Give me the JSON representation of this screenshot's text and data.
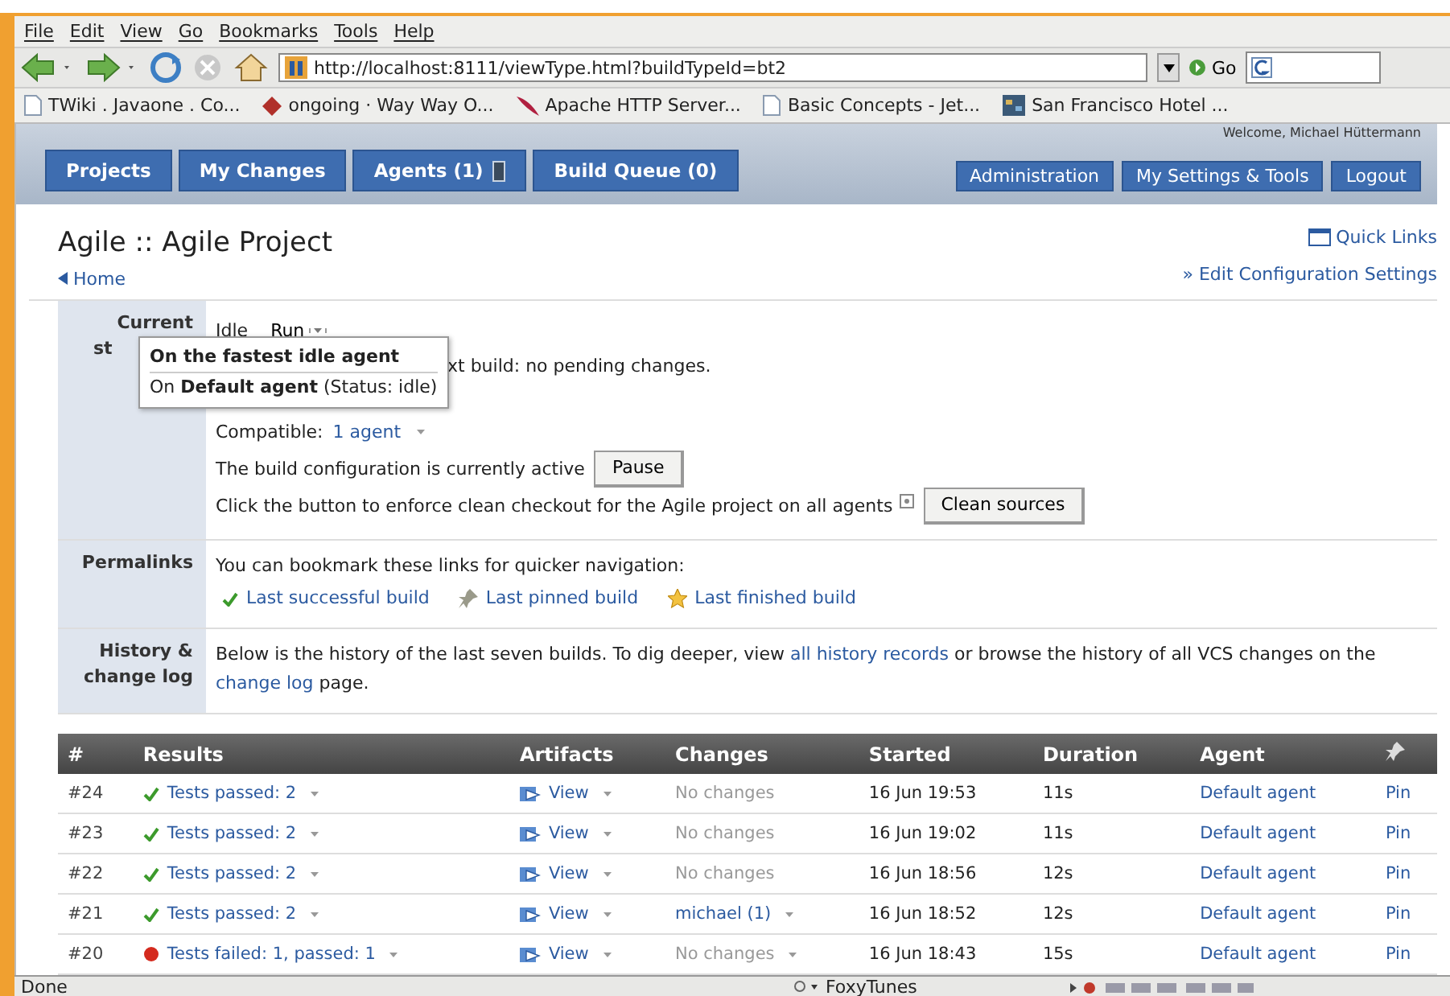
{
  "menu_bar": [
    "File",
    "Edit",
    "View",
    "Go",
    "Bookmarks",
    "Tools",
    "Help"
  ],
  "address_bar": {
    "url": "http://localhost:8111/viewType.html?buildTypeId=bt2",
    "go": "Go"
  },
  "bookmarks": [
    {
      "label": "TWiki . Javaone . Co...",
      "kind": "page"
    },
    {
      "label": "ongoing · Way Way O...",
      "kind": "diamond"
    },
    {
      "label": "Apache HTTP Server...",
      "kind": "feather"
    },
    {
      "label": "Basic Concepts - Jet...",
      "kind": "page"
    },
    {
      "label": "San Francisco Hotel ...",
      "kind": "hotel"
    }
  ],
  "welcome": "Welcome, Michael Hüttermann",
  "nav_tabs": [
    {
      "label": "Projects",
      "kind": "plain"
    },
    {
      "label": "My Changes",
      "kind": "plain"
    },
    {
      "label": "Agents (1)",
      "kind": "agents"
    },
    {
      "label": "Build Queue (0)",
      "kind": "plain"
    }
  ],
  "nav_links": [
    "Administration",
    "My Settings & Tools",
    "Logout"
  ],
  "page_title": "Agile :: Agile Project",
  "quick_links": "Quick Links",
  "home_link": "Home",
  "edit_settings": "» Edit Configuration Settings",
  "current_status": {
    "label_lines": [
      "Current",
      "st"
    ],
    "state": "Idle",
    "run_button": "Run",
    "popup": {
      "title": "On the fastest idle agent",
      "option": "On **Default agent** (Status: idle)"
    },
    "next_build": "xt build: no pending changes.",
    "compatible_label": "Compatible:",
    "compatible_link": "1 agent",
    "active_text": "The build configuration is currently active",
    "pause_button": "Pause",
    "clean_text": "Click the button to enforce clean checkout for the Agile project on all agents",
    "clean_button": "Clean sources"
  },
  "permalinks": {
    "label": "Permalinks",
    "text": "You can bookmark these links for quicker navigation:",
    "links": [
      {
        "label": "Last successful build",
        "kind": "check"
      },
      {
        "label": "Last pinned build",
        "kind": "pin"
      },
      {
        "label": "Last finished build",
        "kind": "star"
      }
    ]
  },
  "history": {
    "label_lines": [
      "History &",
      "change log"
    ],
    "before": "Below is the history of the last seven builds. To dig deeper, view",
    "link1": "all history records",
    "middle": "or browse the history of all VCS changes on the",
    "link2": "change log",
    "after": "page."
  },
  "table": {
    "columns": [
      "#",
      "Results",
      "Artifacts",
      "Changes",
      "Started",
      "Duration",
      "Agent"
    ],
    "rows": [
      {
        "number": "#24",
        "passed": true,
        "result": "Tests passed: 2",
        "artifacts": "View",
        "changes": "No changes",
        "has_changes": false,
        "changes_menu": false,
        "started": "16 Jun 19:53",
        "duration": "11s",
        "agent": "Default agent",
        "pin": "Pin"
      },
      {
        "number": "#23",
        "passed": true,
        "result": "Tests passed: 2",
        "artifacts": "View",
        "changes": "No changes",
        "has_changes": false,
        "changes_menu": false,
        "started": "16 Jun 19:02",
        "duration": "11s",
        "agent": "Default agent",
        "pin": "Pin"
      },
      {
        "number": "#22",
        "passed": true,
        "result": "Tests passed: 2",
        "artifacts": "View",
        "changes": "No changes",
        "has_changes": false,
        "changes_menu": false,
        "started": "16 Jun 18:56",
        "duration": "12s",
        "agent": "Default agent",
        "pin": "Pin"
      },
      {
        "number": "#21",
        "passed": true,
        "result": "Tests passed: 2",
        "artifacts": "View",
        "changes": "michael (1)",
        "has_changes": true,
        "changes_menu": true,
        "started": "16 Jun 18:52",
        "duration": "12s",
        "agent": "Default agent",
        "pin": "Pin"
      },
      {
        "number": "#20",
        "passed": false,
        "result": "Tests failed: 1, passed: 1",
        "artifacts": "View",
        "changes": "No changes",
        "has_changes": false,
        "changes_menu": true,
        "started": "16 Jun 18:43",
        "duration": "15s",
        "agent": "Default agent",
        "pin": "Pin"
      }
    ]
  },
  "status_bar": {
    "text": "Done",
    "foxytunes": "FoxyTunes"
  }
}
